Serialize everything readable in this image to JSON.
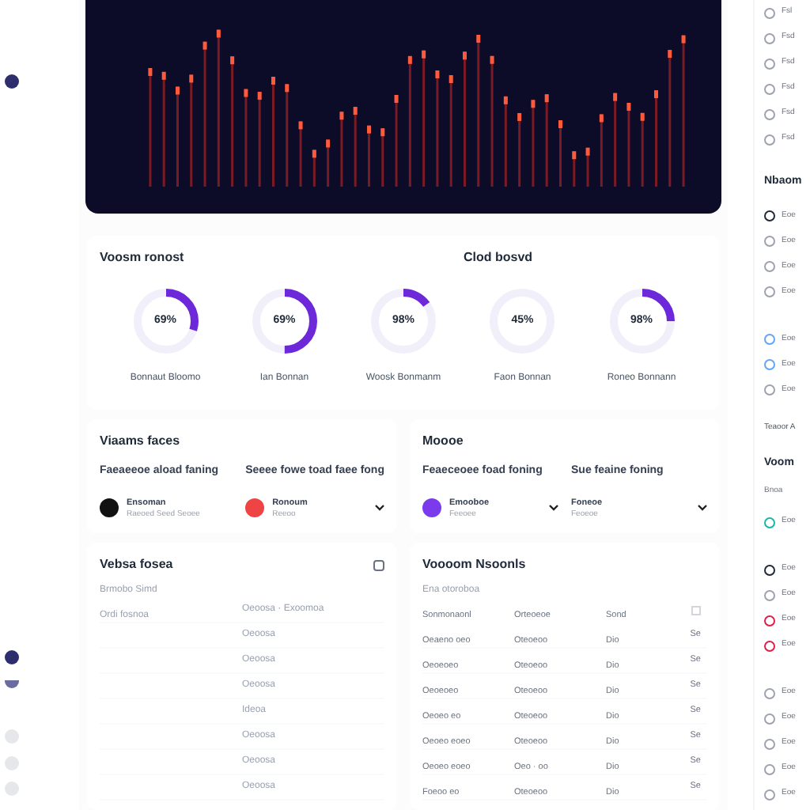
{
  "donut_card": {
    "titles": [
      "Voosm ronost",
      "Clod bosvd"
    ],
    "donuts": [
      {
        "value": "69%",
        "caption": "Bonnaut Bloomo",
        "level": 0.3
      },
      {
        "value": "69%",
        "caption": "Ian Bonnan",
        "level": 0.5
      },
      {
        "value": "98%",
        "caption": "Woosk Bonmanm",
        "level": 0.15
      },
      {
        "value": "45%",
        "caption": "Faon Bonnan",
        "level": 0
      },
      {
        "value": "98%",
        "caption": "Roneo Bonnann",
        "level": 0.25
      }
    ]
  },
  "people_cards": [
    {
      "title": "Viaams faces",
      "columns": [
        {
          "heading": "Faeaeeoe aload faning",
          "name": "Ensoman",
          "detail": "Raeoed Seed Seoee",
          "color": "#111111",
          "chevron": false
        },
        {
          "heading": "Seeee fowe toad faee fong",
          "name": "Ronoum",
          "detail": "Reeoo",
          "color": "#ef4444",
          "chevron": true
        }
      ]
    },
    {
      "title": "Moooe",
      "columns": [
        {
          "heading": "Feaeceoee foad foning",
          "name": "Emooboe",
          "detail": "Feeoee",
          "color": "#7c3aed",
          "chevron": true
        },
        {
          "heading": "Sue feaine foning",
          "name": "Foneoe",
          "detail": "Feoeoe",
          "chevron": true
        }
      ]
    }
  ],
  "left_table": {
    "title": "Vebsa fosea",
    "subtitle": "Brmobo Simd",
    "label": "Ordi fosnoa",
    "rows": [
      "Oeoosa · Exoomoa",
      "Oeoosa",
      "Oeoosa",
      "Oeoosa",
      "Ideoa",
      "Oeoosa",
      "Oeoosa",
      "Oeoosa"
    ]
  },
  "right_table": {
    "title": "Voooom Nsoonls",
    "subtitle": "Ena otoroboa",
    "columns": [
      "Sonmonaonl",
      "Orteoeoe",
      "Sond"
    ],
    "header_checked": false,
    "rows": [
      [
        "Oeaeno oeo",
        "Oteoeoo",
        "Dio",
        "Se"
      ],
      [
        "Oeoeoeo",
        "Oteoeoo",
        "Dio",
        "Se"
      ],
      [
        "Oeoeoeo",
        "Oteoeoo",
        "Dio",
        "Se"
      ],
      [
        "Oeoeo eo",
        "Oteoeoo",
        "Dio",
        "Se"
      ],
      [
        "Oeoeo eoeo",
        "Oteoeoo",
        "Dio",
        "Se"
      ],
      [
        "Oeoeo eoeo",
        "Oeo · oo",
        "Dio",
        "Se"
      ],
      [
        "Foeoo eo",
        "Oteoeoo",
        "Dio",
        "Se"
      ]
    ]
  },
  "sidebar": {
    "groups": [
      {
        "items": [
          {
            "label": "Fsl",
            "color": "#9ca3af"
          },
          {
            "label": "Fsd",
            "color": "#9ca3af"
          },
          {
            "label": "Fsd",
            "color": "#9ca3af"
          },
          {
            "label": "Fsd",
            "color": "#9ca3af"
          },
          {
            "label": "Fsd",
            "color": "#9ca3af"
          },
          {
            "label": "Fsd",
            "color": "#9ca3af"
          }
        ]
      },
      {
        "heading": "Nbaom",
        "items": [
          {
            "label": "Eoe",
            "color": "#1f2937"
          },
          {
            "label": "Eoe",
            "color": "#9ca3af"
          },
          {
            "label": "Eoe",
            "color": "#9ca3af"
          },
          {
            "label": "Eoe",
            "color": "#9ca3af"
          }
        ]
      },
      {
        "items": [
          {
            "label": "Eoe",
            "color": "#60a5fa"
          },
          {
            "label": "Eoe",
            "color": "#60a5fa"
          },
          {
            "label": "Eoe",
            "color": "#9ca3af"
          }
        ],
        "note": "Teaoor A"
      },
      {
        "heading": "Voom",
        "text": "Bnoa",
        "items": [
          {
            "label": "Eoe",
            "color": "#14b8a6"
          }
        ]
      },
      {
        "items": [
          {
            "label": "Eoe",
            "color": "#1f2937"
          },
          {
            "label": "Eoe",
            "color": "#9ca3af"
          },
          {
            "label": "Eoe",
            "color": "#e11d48"
          },
          {
            "label": "Eoe",
            "color": "#e11d48"
          }
        ]
      },
      {
        "items": [
          {
            "label": "Eoe",
            "color": "#9ca3af"
          },
          {
            "label": "Eoe",
            "color": "#9ca3af"
          },
          {
            "label": "Eoe",
            "color": "#9ca3af"
          },
          {
            "label": "Eoe",
            "color": "#9ca3af"
          },
          {
            "label": "Eoe",
            "color": "#9ca3af"
          }
        ]
      }
    ]
  }
}
